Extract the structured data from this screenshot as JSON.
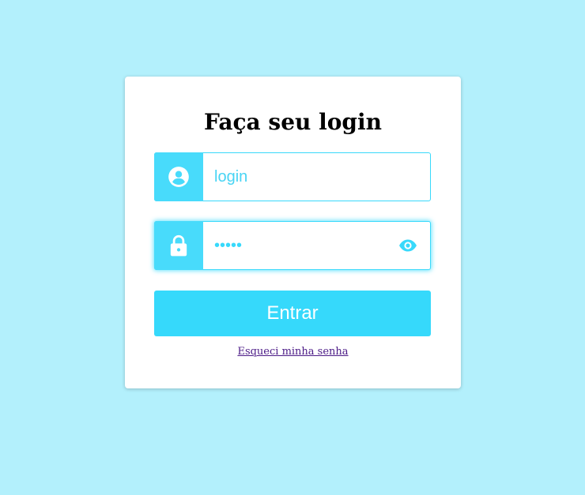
{
  "background_color": "#b3f0fc",
  "accent_color": "#48dbfb",
  "card": {
    "title": "Faça seu login"
  },
  "login_field": {
    "icon": "user-circle-icon",
    "placeholder": "login",
    "value": ""
  },
  "password_field": {
    "icon": "lock-icon",
    "value": "•••••",
    "toggle_icon": "eye-icon"
  },
  "submit_button": {
    "label": "Entrar"
  },
  "forgot_link": {
    "label": "Esqueci minha senha"
  }
}
